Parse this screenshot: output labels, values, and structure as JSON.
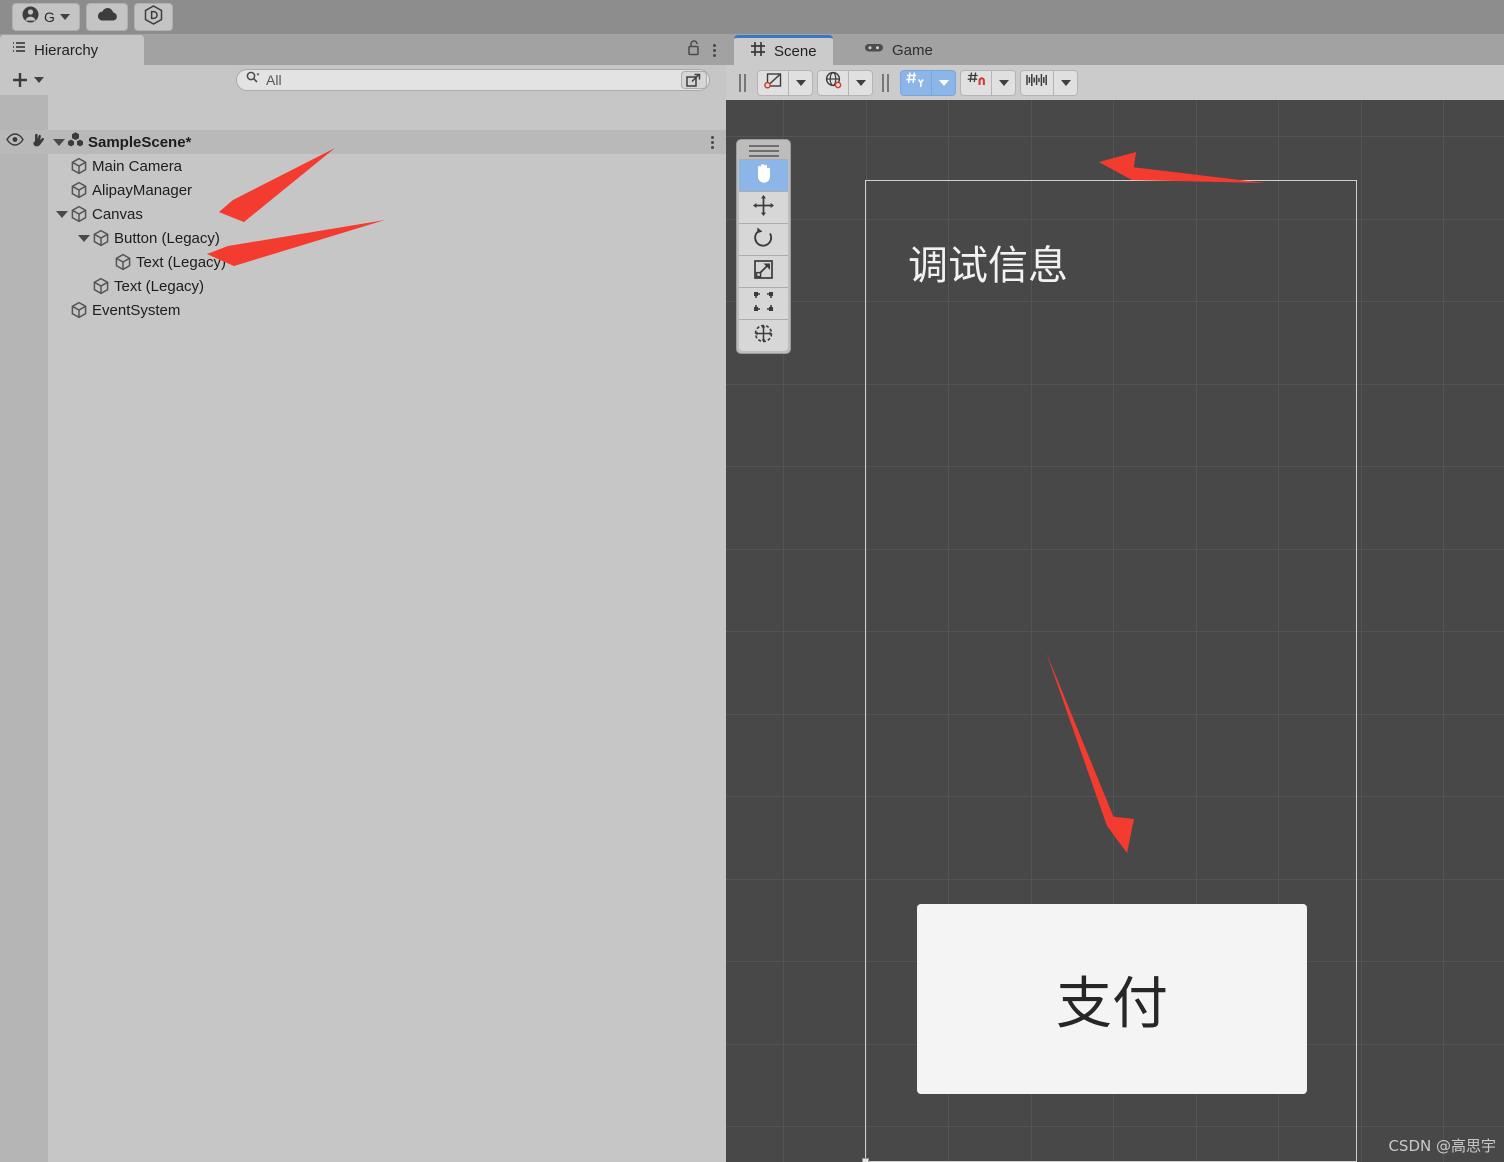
{
  "top_toolbar": {
    "account_button": {
      "icon": "account-avatar-icon",
      "label": "G",
      "has_caret": true
    },
    "cloud_button": {
      "icon": "cloud-icon"
    },
    "services_button": {
      "icon": "unity-hex-d-icon",
      "label": "D"
    }
  },
  "hierarchy": {
    "tab_label": "Hierarchy",
    "tab_icon": "hierarchy-list-icon",
    "lock_icon": "lock-open-icon",
    "menu_icon": "kebab-menu-icon",
    "add_button_label": "+",
    "search": {
      "placeholder": "All",
      "value": "All",
      "icon": "search-icon",
      "expand_icon": "search-expand-icon"
    },
    "scene_row": {
      "name": "SampleScene*",
      "visibility_icon": "eye-icon",
      "pickability_icon": "hand-pointer-icon",
      "expanded": true,
      "icon": "unity-scene-icon"
    },
    "items": [
      {
        "name": "Main Camera",
        "depth": 1,
        "expandable": false,
        "icon": "gameobject-cube-icon"
      },
      {
        "name": "AlipayManager",
        "depth": 1,
        "expandable": false,
        "icon": "gameobject-cube-icon"
      },
      {
        "name": "Canvas",
        "depth": 1,
        "expandable": true,
        "expanded": true,
        "icon": "gameobject-cube-icon"
      },
      {
        "name": "Button (Legacy)",
        "depth": 2,
        "expandable": true,
        "expanded": true,
        "icon": "gameobject-cube-icon"
      },
      {
        "name": "Text (Legacy)",
        "depth": 3,
        "expandable": false,
        "icon": "gameobject-cube-icon"
      },
      {
        "name": "Text (Legacy)",
        "depth": 2,
        "expandable": false,
        "icon": "gameobject-cube-icon"
      },
      {
        "name": "EventSystem",
        "depth": 1,
        "expandable": false,
        "icon": "gameobject-cube-icon"
      }
    ]
  },
  "scene_panel": {
    "tabs": [
      {
        "label": "Scene",
        "icon": "scene-grid-icon",
        "active": true
      },
      {
        "label": "Game",
        "icon": "gamepad-icon",
        "active": false
      }
    ],
    "toolbar": [
      {
        "name": "draw-mode-button",
        "icon": "shaded-wireframe-icon",
        "active": false
      },
      {
        "name": "draw-mode-dropdown",
        "icon": "caret-down-icon",
        "active": false
      },
      {
        "name": "scene-lighting-button",
        "icon": "globe-audio-icon",
        "active": false
      },
      {
        "name": "scene-fx-dropdown",
        "icon": "caret-down-icon",
        "active": false
      },
      {
        "name": "grid-axis-button",
        "icon": "grid-y-axis-icon",
        "active": true
      },
      {
        "name": "grid-axis-dropdown",
        "icon": "caret-down-icon",
        "active": true
      },
      {
        "name": "snap-increment-button",
        "icon": "grid-magnet-icon",
        "active": false
      },
      {
        "name": "snap-increment-dropdown",
        "icon": "caret-down-icon",
        "active": false
      },
      {
        "name": "component-tools-button",
        "icon": "component-tools-icon",
        "active": false
      },
      {
        "name": "component-tools-dropdown",
        "icon": "caret-down-icon",
        "active": false
      }
    ],
    "tool_palette": [
      {
        "name": "hand-tool",
        "icon": "hand-icon",
        "active": true
      },
      {
        "name": "move-tool",
        "icon": "move-arrows-icon",
        "active": false
      },
      {
        "name": "rotate-tool",
        "icon": "rotate-icon",
        "active": false
      },
      {
        "name": "scale-tool",
        "icon": "scale-icon",
        "active": false
      },
      {
        "name": "rect-tool",
        "icon": "rect-transform-icon",
        "active": false
      },
      {
        "name": "transform-tool",
        "icon": "combined-transform-icon",
        "active": false
      }
    ]
  },
  "scene_view": {
    "background_color": "#484848",
    "grid_line_color": "#545454",
    "canvas_outline_color": "#cfcfcf",
    "debug_text": "调试信息",
    "pay_button_label": "支付",
    "pay_button_color": "#f4f4f4",
    "watermark": "CSDN @高思宇",
    "annotation_color": "#f33b30",
    "annotations": [
      {
        "name": "arrow-to-button-legacy",
        "target": "Button (Legacy)"
      },
      {
        "name": "arrow-to-text-legacy",
        "target": "Text (Legacy)"
      },
      {
        "name": "arrow-to-debug-text",
        "target": "调试信息"
      },
      {
        "name": "arrow-to-pay-button",
        "target": "支付"
      }
    ]
  }
}
